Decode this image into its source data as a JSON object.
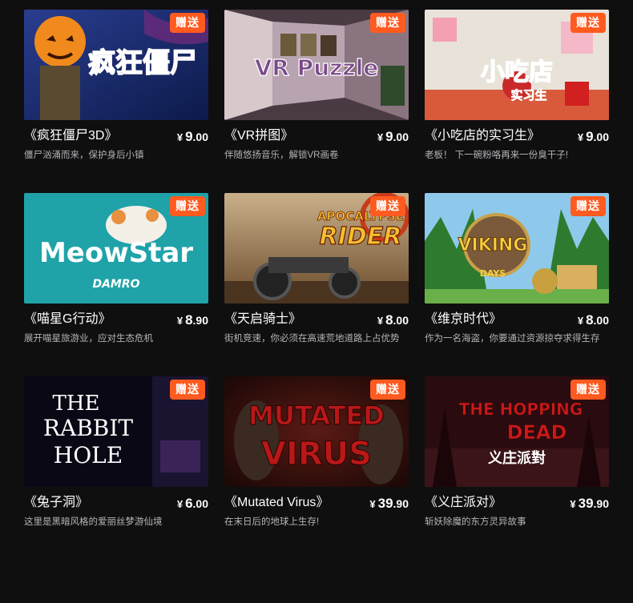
{
  "badge_text": "赠送",
  "currency": "¥",
  "games": [
    {
      "title": "《疯狂僵尸3D》",
      "price_int": "9",
      "price_dec": ".00",
      "desc": "僵尸汹涌而来，保护身后小镇",
      "art_text": "疯狂僵尸"
    },
    {
      "title": "《VR拼图》",
      "price_int": "9",
      "price_dec": ".00",
      "desc": "伴随悠扬音乐，解锁VR画卷",
      "art_text": "VR Puzzle"
    },
    {
      "title": "《小吃店的实习生》",
      "price_int": "9",
      "price_dec": ".00",
      "desc": "老板！ 下一碗粉咯再来一份臭干子!",
      "art_text": "小吃店",
      "art_sub": "实习生"
    },
    {
      "title": "《喵星G行动》",
      "price_int": "8",
      "price_dec": ".90",
      "desc": "展开喵星旅游业，应对生态危机",
      "art_text": "MeowStar",
      "art_sub": "DAMRO"
    },
    {
      "title": "《天启骑士》",
      "price_int": "8",
      "price_dec": ".00",
      "desc": "街机竞速，你必须在高速荒地道路上占优势",
      "art_text": "APOCALYPSE",
      "art_sub": "RIDER"
    },
    {
      "title": "《维京时代》",
      "price_int": "8",
      "price_dec": ".00",
      "desc": "作为一名海盗，你要通过资源掠夺求得生存",
      "art_text": "VIKING",
      "art_sub": "DAYS"
    },
    {
      "title": "《兔子洞》",
      "price_int": "6",
      "price_dec": ".00",
      "desc": "这里是黑暗风格的爱丽丝梦游仙境",
      "art_text": "THE",
      "art_sub": "RABBIT",
      "art_sub2": "HOLE"
    },
    {
      "title": "《Mutated Virus》",
      "price_int": "39",
      "price_dec": ".90",
      "desc": "在末日后的地球上生存!",
      "art_text": "MUTATED",
      "art_sub": "VIRUS"
    },
    {
      "title": "《义庄派对》",
      "price_int": "39",
      "price_dec": ".90",
      "desc": "斩妖除魔的东方灵异故事",
      "art_text": "THE HOPPING",
      "art_sub": "DEAD",
      "art_sub2": "义庄派對"
    }
  ]
}
